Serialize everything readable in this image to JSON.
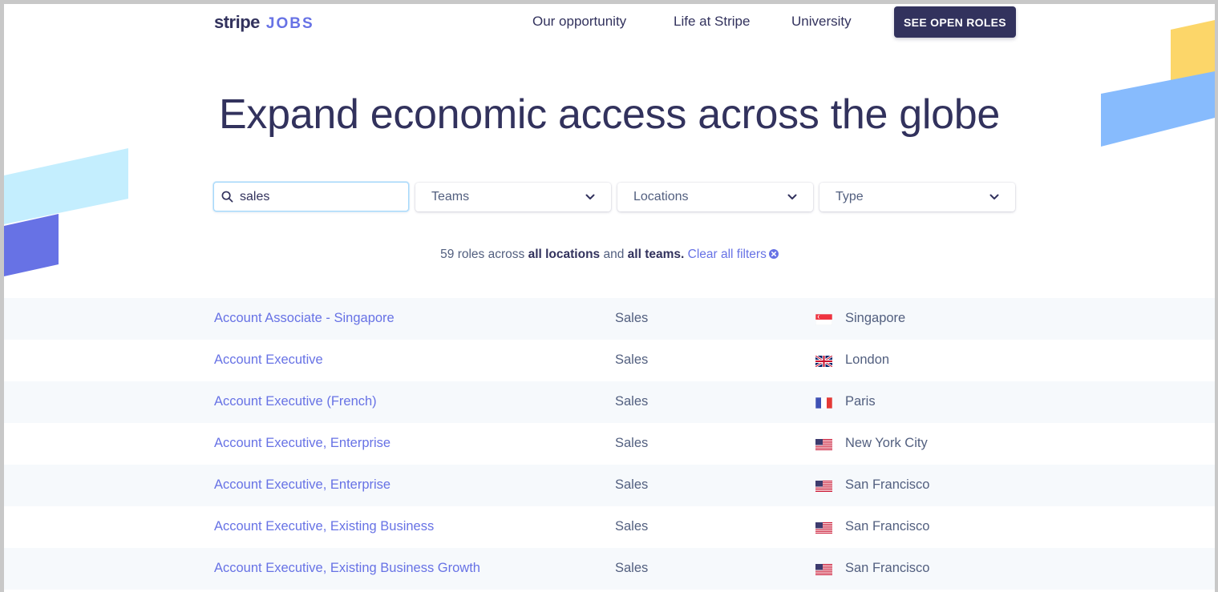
{
  "header": {
    "logo_text": "stripe",
    "logo_suffix": "JOBS",
    "nav": [
      {
        "label": "Our opportunity"
      },
      {
        "label": "Life at Stripe"
      },
      {
        "label": "University"
      }
    ],
    "cta_label": "SEE OPEN ROLES"
  },
  "hero": {
    "title": "Expand economic access across the globe"
  },
  "filters": {
    "search_value": "sales",
    "search_icon": "search-icon",
    "teams_label": "Teams",
    "locations_label": "Locations",
    "type_label": "Type"
  },
  "summary": {
    "count_text": "59 roles across",
    "locations_text": "all locations",
    "and_text": "and",
    "teams_text": "all teams.",
    "clear_label": "Clear all filters"
  },
  "roles": [
    {
      "title": "Account Associate - Singapore",
      "team": "Sales",
      "flag": "singapore-flag-icon",
      "location": "Singapore"
    },
    {
      "title": "Account Executive",
      "team": "Sales",
      "flag": "uk-flag-icon",
      "location": "London"
    },
    {
      "title": "Account Executive (French)",
      "team": "Sales",
      "flag": "france-flag-icon",
      "location": "Paris"
    },
    {
      "title": "Account Executive, Enterprise",
      "team": "Sales",
      "flag": "us-flag-icon",
      "location": "New York City"
    },
    {
      "title": "Account Executive, Enterprise",
      "team": "Sales",
      "flag": "us-flag-icon",
      "location": "San Francisco"
    },
    {
      "title": "Account Executive, Existing Business",
      "team": "Sales",
      "flag": "us-flag-icon",
      "location": "San Francisco"
    },
    {
      "title": "Account Executive, Existing Business Growth",
      "team": "Sales",
      "flag": "us-flag-icon",
      "location": "San Francisco"
    }
  ],
  "colors": {
    "primary": "#6772e5",
    "dark": "#32325d",
    "row_alt": "#f6f9fc",
    "accent_yellow": "#fcd669",
    "accent_blue": "#87bbfd",
    "accent_light_blue": "#c4eefe"
  }
}
